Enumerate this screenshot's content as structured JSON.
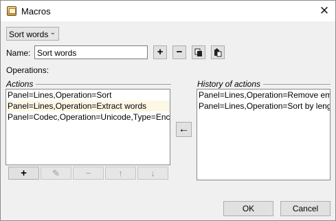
{
  "window": {
    "title": "Macros",
    "app_icon": "macros-app-icon",
    "close_glyph": "✕"
  },
  "macro_select": {
    "value": "Sort words",
    "arrow": "⌄"
  },
  "name": {
    "label": "Name:",
    "value": "Sort words"
  },
  "toolbar": {
    "add_glyph": "+",
    "remove_glyph": "−"
  },
  "operations_label": "Operations:",
  "actions": {
    "title": "Actions",
    "items": [
      "Panel=Lines,Operation=Sort",
      "Panel=Lines,Operation=Extract words",
      "Panel=Codec,Operation=Unicode,Type=Encode"
    ],
    "buttons": {
      "add": "+",
      "edit": "✎",
      "remove": "−",
      "up": "↑",
      "down": "↓"
    }
  },
  "history": {
    "title": "History of actions",
    "items": [
      "Panel=Lines,Operation=Remove empty",
      "Panel=Lines,Operation=Sort by length"
    ]
  },
  "move_button": {
    "glyph": "←"
  },
  "buttons": {
    "ok": "OK",
    "cancel": "Cancel"
  }
}
